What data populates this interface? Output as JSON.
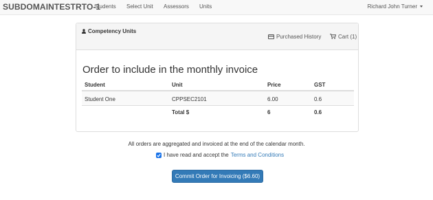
{
  "navbar": {
    "brand": "SUBDOMAINTESTRTO-1",
    "links": [
      "Students",
      "Select Unit",
      "Assessors",
      "Units"
    ],
    "user": "Richard John Turner"
  },
  "panel": {
    "title": "Competency Units",
    "purchased_history": "Purchased History",
    "cart": "Cart (1)"
  },
  "order": {
    "title": "Order to include in the monthly invoice",
    "columns": [
      "Student",
      "Unit",
      "Price",
      "GST"
    ],
    "rows": [
      {
        "student": "Student One",
        "unit": "CPPSEC2101",
        "price": "6.00",
        "gst": "0.6"
      }
    ],
    "total": {
      "label": "Total $",
      "price": "6",
      "gst": "0.6"
    }
  },
  "footer": {
    "note": "All orders are aggregated and invoiced at the end of the calendar month.",
    "accept_text": "I have read and accept the",
    "terms_link": "Terms and Conditions",
    "accept_checked": true,
    "commit_button": "Commit Order for Invoicing ($6.60)"
  },
  "colors": {
    "primary": "#337ab7",
    "navbar_bg": "#f8f8f8",
    "checkbox": "#1a73e8"
  }
}
